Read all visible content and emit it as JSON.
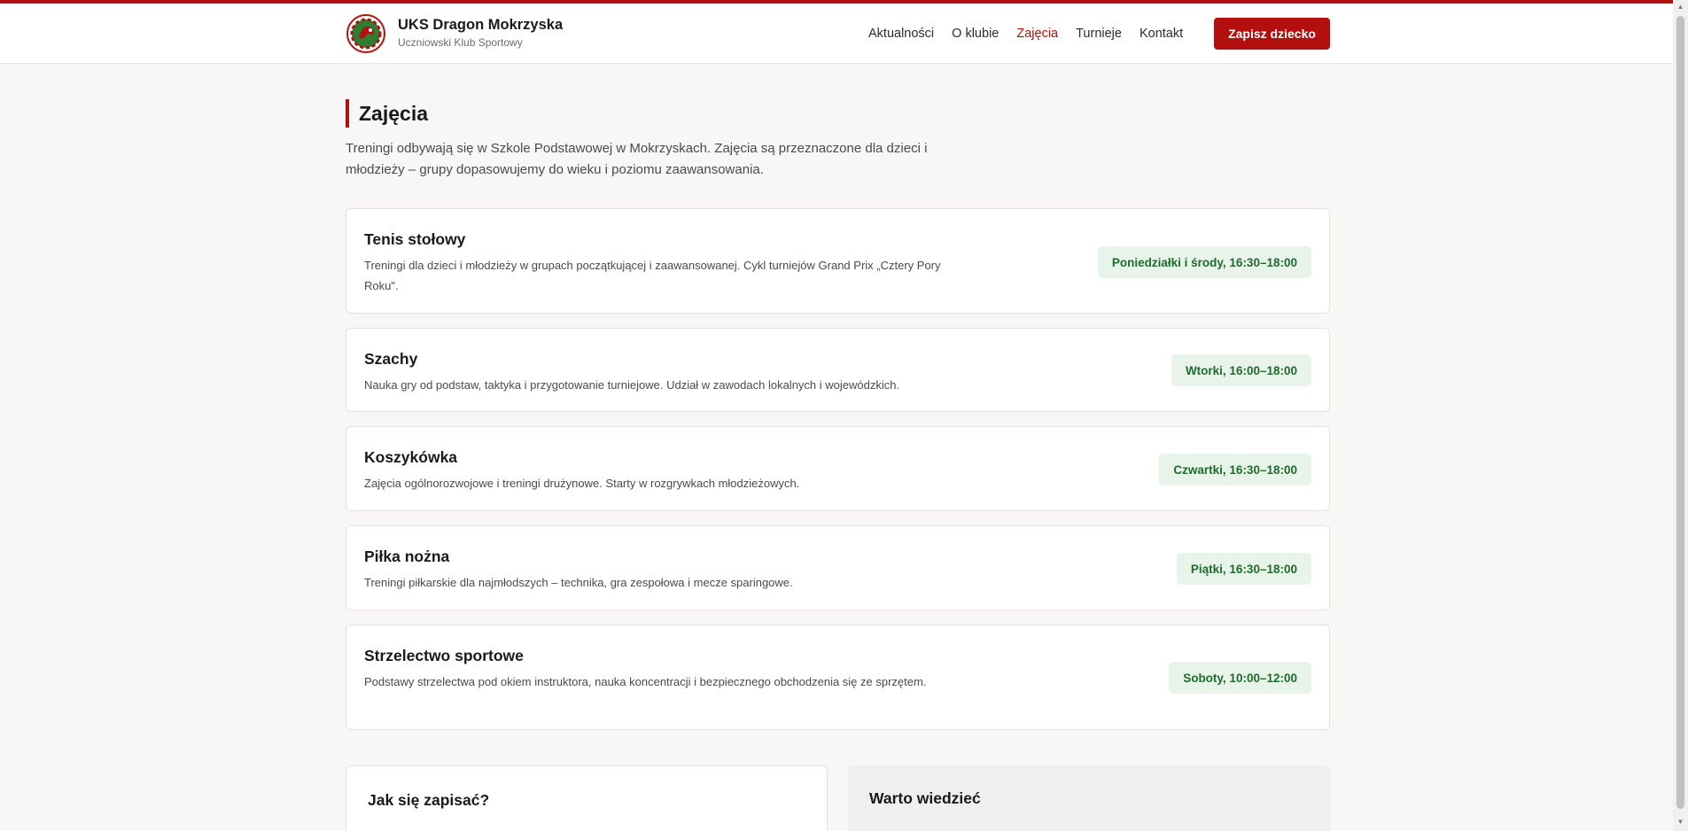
{
  "header": {
    "brand_title": "UKS Dragon Mokrzyska",
    "brand_subtitle": "Uczniowski Klub Sportowy",
    "logo_icon": "club-crest-icon",
    "nav": [
      {
        "label": "Aktualności",
        "active": false
      },
      {
        "label": "O klubie",
        "active": false
      },
      {
        "label": "Zajęcia",
        "active": true
      },
      {
        "label": "Turnieje",
        "active": false
      },
      {
        "label": "Kontakt",
        "active": false
      }
    ],
    "cta_label": "Zapisz dziecko"
  },
  "main": {
    "title": "Zajęcia",
    "intro": "Treningi odbywają się w Szkole Podstawowej w Mokrzyskach. Zajęcia są przeznaczone dla dzieci i młodzieży – grupy dopasowujemy do wieku i poziomu zaawansowania.",
    "activities": [
      {
        "name": "Tenis stołowy",
        "description": "Treningi dla dzieci i młodzieży w grupach początkującej i zaawansowanej. Cykl turniejów Grand Prix „Cztery Pory Roku\".",
        "schedule": "Poniedziałki i środy, 16:30–18:00"
      },
      {
        "name": "Szachy",
        "description": "Nauka gry od podstaw, taktyka i przygotowanie turniejowe. Udział w zawodach lokalnych i wojewódzkich.",
        "schedule": "Wtorki, 16:00–18:00"
      },
      {
        "name": "Koszykówka",
        "description": "Zajęcia ogólnorozwojowe i treningi drużynowe. Starty w rozgrywkach młodzieżowych.",
        "schedule": "Czwartki, 16:30–18:00"
      },
      {
        "name": "Piłka nożna",
        "description": "Treningi piłkarskie dla najmłodszych – technika, gra zespołowa i mecze sparingowe.",
        "schedule": "Piątki, 16:30–18:00"
      },
      {
        "name": "Strzelectwo sportowe",
        "description": "Podstawy strzelectwa pod okiem instruktora, nauka koncentracji i bezpiecznego obchodzenia się ze sprzętem.",
        "schedule": "Soboty, 10:00–12:00"
      }
    ],
    "how_to_join_title": "Jak się zapisać?",
    "good_to_know_title": "Warto wiedzieć"
  },
  "colors": {
    "accent": "#b30f0f",
    "badge_bg": "#e8f4ea",
    "badge_text": "#1f6b2c",
    "page_bg": "#f8f7f5"
  }
}
